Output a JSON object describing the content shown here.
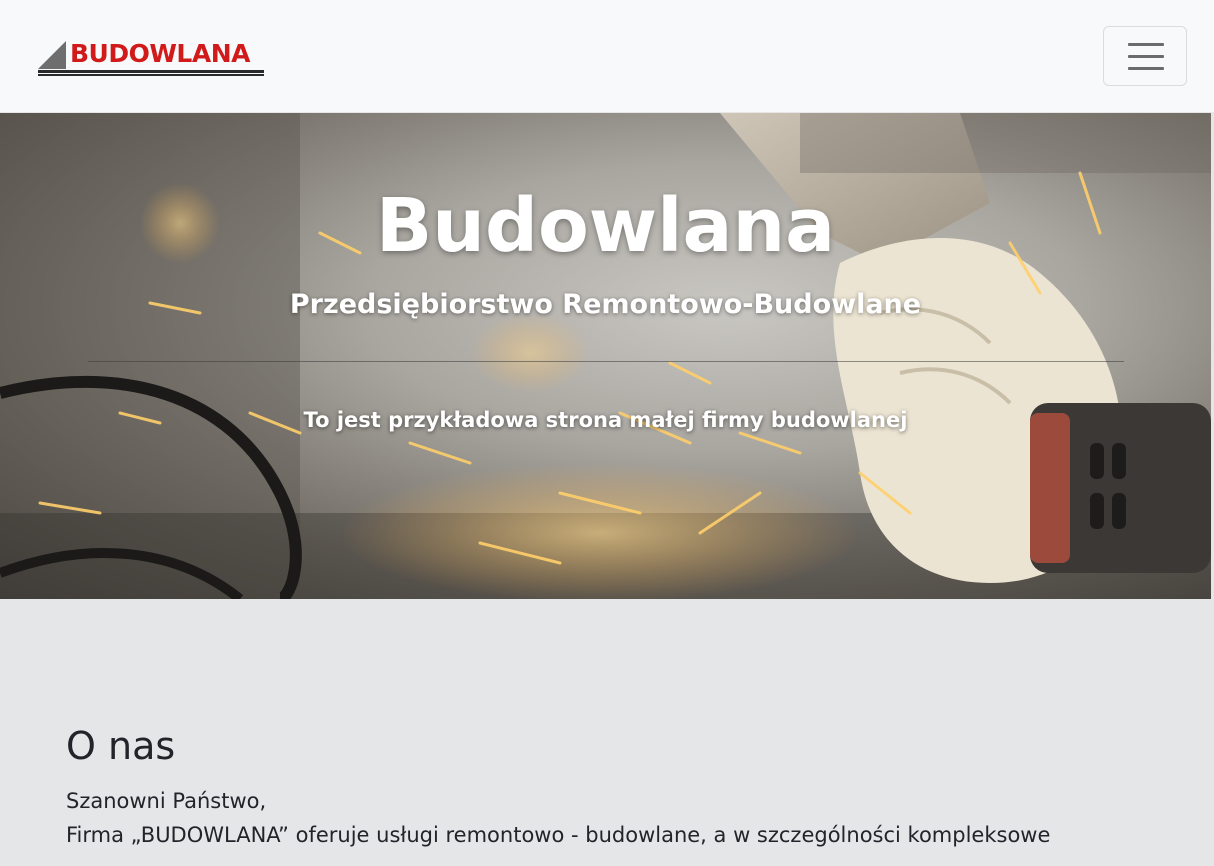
{
  "navbar": {
    "logo_text": "BUDOWLANA",
    "toggler_icon": "hamburger-icon"
  },
  "hero": {
    "title": "Budowlana",
    "subtitle": "Przedsiębiorstwo Remontowo-Budowlane",
    "lead": "To jest przykładowa strona małej firmy budowlanej"
  },
  "about": {
    "heading": "O nas",
    "greeting": "Szanowni Państwo,",
    "body": "Firma „BUDOWLANA” oferuje usługi remontowo - budowlane, a w szczególności kompleksowe"
  },
  "colors": {
    "logo_red": "#d11a1a",
    "navbar_bg": "#f8f9fa",
    "section_bg": "#e5e6e8",
    "text_dark": "#212529"
  }
}
